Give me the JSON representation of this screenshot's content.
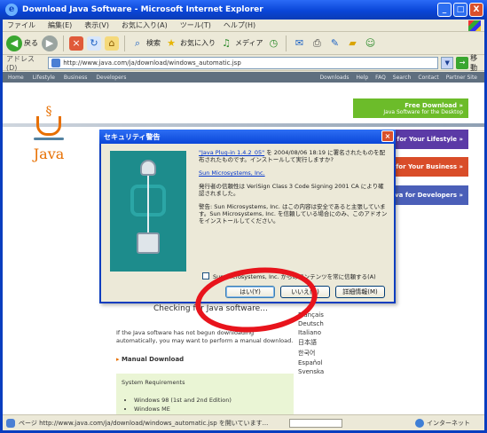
{
  "window": {
    "title": "Download Java Software - Microsoft Internet Explorer",
    "controls": [
      "_",
      "□",
      "X"
    ]
  },
  "menubar": {
    "items": [
      "ファイル",
      "編集(E)",
      "表示(V)",
      "お気に入り(A)",
      "ツール(T)",
      "ヘルプ(H)"
    ]
  },
  "toolbar": {
    "back_label": "戻る",
    "search_label": "検索",
    "favorites_label": "お気に入り",
    "media_label": "メディア"
  },
  "addressbar": {
    "label": "アドレス(D)",
    "url": "http://www.java.com/ja/download/windows_automatic.jsp",
    "go_label": "移動"
  },
  "site": {
    "topnav_left": [
      "Home",
      "Lifestyle",
      "Business",
      "Developers"
    ],
    "topnav_right": [
      "Downloads",
      "Help",
      "FAQ",
      "Search",
      "Contact",
      "Partner Site"
    ],
    "logo_text": "Java",
    "promos": {
      "free_title": "Free Download »",
      "free_sub": "Java Software for the Desktop",
      "lifestyle": "Java for Your Lifestyle »",
      "business": "Java for Your Business »",
      "developers": "Java for Developers »"
    },
    "checking_text": "Checking for Java software...",
    "languages": [
      "Français",
      "Deutsch",
      "Italiano",
      "日本語",
      "한국어",
      "Español",
      "Svenska"
    ],
    "info_text": "If the Java software has not begun downloading automatically, you may want to perform a manual download.",
    "manual_download": "Manual Download",
    "sysreq_title": "System Requirements",
    "sysreq_items": [
      "Windows 98 (1st and 2nd Edition)",
      "Windows ME"
    ]
  },
  "dialog": {
    "title": "セキュリティ警告",
    "paragraph1_link": "\"Java Plug-in 1.4.2_05\"",
    "paragraph1": "を 2004/08/06 18:19 に署名されたものを配布されたものです。インストールして実行しますか?",
    "publisher_link": "Sun Microsystems, Inc.",
    "paragraph2": "発行者の信頼性は VeriSign Class 3 Code Signing 2001 CA により確認されました。",
    "paragraph3": "警告: Sun Microsystems, Inc. はこの内容は安全であると主張しています。Sun Microsystems, Inc. を信頼している場合にのみ、このアドオンをインストールしてください。",
    "checkbox_label": "Sun Microsystems, Inc. からのコンテンツを常に信頼する(A)",
    "yes_button": "はい(Y)",
    "no_button": "いいえ(N)",
    "details_button": "詳細情報(M)"
  },
  "statusbar": {
    "text": "ページ http://www.java.com/ja/download/windows_automatic.jsp を開いています...",
    "progress": 0,
    "zone": "インターネット"
  },
  "colors": {
    "highlight_ring": "#e8141c",
    "java_orange": "#e76f00",
    "xp_title_blue": "#0a46d8"
  }
}
